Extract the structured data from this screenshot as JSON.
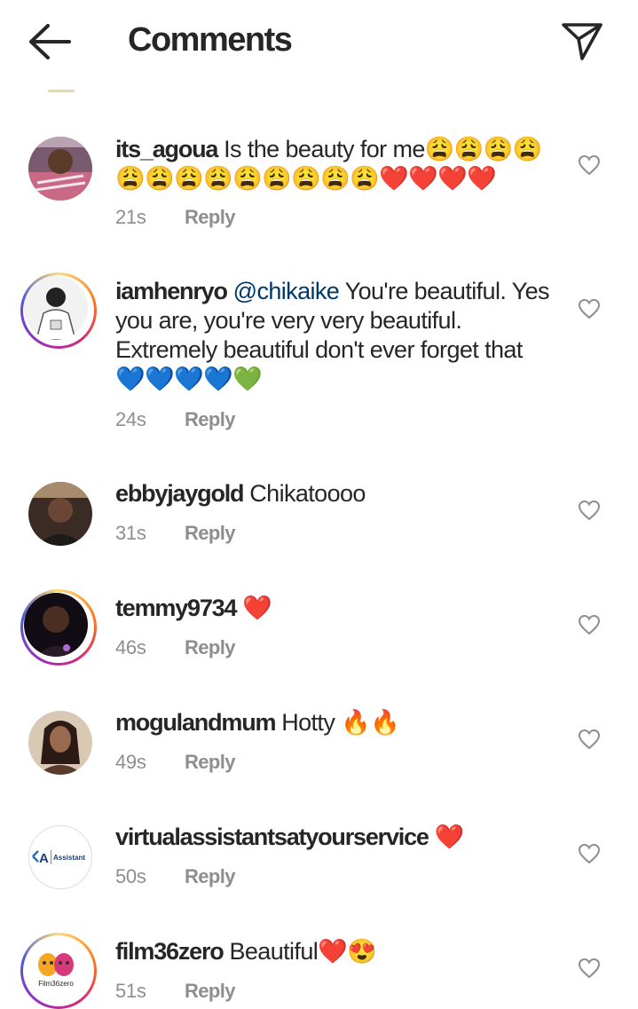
{
  "header": {
    "title": "Comments",
    "back_icon": "arrow-left-icon",
    "send_icon": "paper-plane-icon"
  },
  "reply_label": "Reply",
  "comments": [
    {
      "username": "its_agoua",
      "mention": "",
      "text": "Is the beauty for me",
      "emoji": "😩😩😩😩😩😩😩😩😩😩😩😩😩❤️❤️❤️❤️",
      "time": "21s",
      "story_ring": false
    },
    {
      "username": "iamhenryo",
      "mention": "@chikaike",
      "text": "You're beautiful. Yes you are, you're very very beautiful. Extremely beautiful don't ever forget that",
      "emoji": "💙💙💙💙💚",
      "time": "24s",
      "story_ring": true
    },
    {
      "username": "ebbyjaygold",
      "mention": "",
      "text": "Chikatoooo",
      "emoji": "",
      "time": "31s",
      "story_ring": false
    },
    {
      "username": "temmy9734",
      "mention": "",
      "text": "",
      "emoji": "❤️",
      "time": "46s",
      "story_ring": true
    },
    {
      "username": "mogulandmum",
      "mention": "",
      "text": "Hotty",
      "emoji": "🔥🔥",
      "time": "49s",
      "story_ring": false
    },
    {
      "username": "virtualassistantsatyourservice",
      "mention": "",
      "text": "",
      "emoji": "❤️",
      "time": "50s",
      "story_ring": false
    },
    {
      "username": "film36zero",
      "mention": "",
      "text": "Beautiful",
      "emoji": "❤️😍",
      "time": "51s",
      "story_ring": true
    }
  ],
  "logos": {
    "virtual_assistant": "Assistant",
    "film36zero": "Film36zero"
  },
  "colors": {
    "mention": "#00376b",
    "meta": "#8e8e8e",
    "text": "#262626"
  }
}
